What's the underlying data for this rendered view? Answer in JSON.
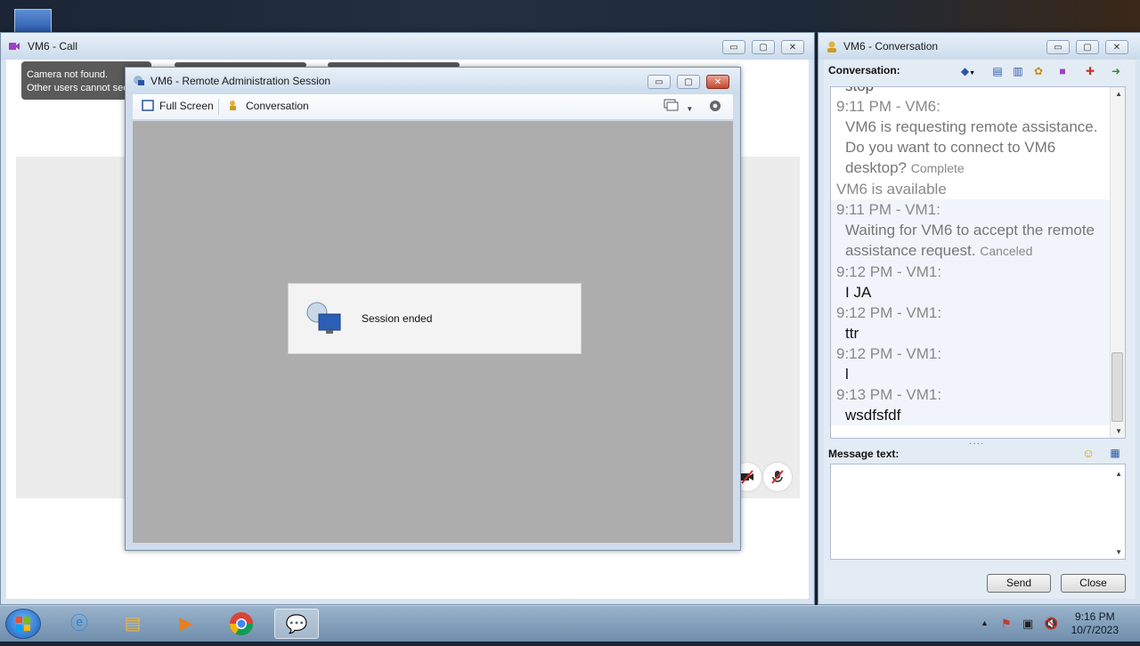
{
  "call_window": {
    "title": "VM6 - Call",
    "controls": {
      "minimize": "▭",
      "maximize": "▢",
      "close": "✕"
    },
    "camera_tip": {
      "line1": "Camera not found.",
      "line2": "Other users cannot see"
    },
    "video_button_icon": "video-off-icon",
    "mic_button_icon": "mic-off-icon"
  },
  "remote_window": {
    "title": "VM6 - Remote Administration Session",
    "controls": {
      "minimize": "▭",
      "maximize": "▢",
      "close": "✕"
    },
    "toolbar": {
      "full_screen": "Full Screen",
      "conversation": "Conversation"
    },
    "session_message": "Session ended"
  },
  "conversation_window": {
    "title": "VM6 - Conversation",
    "controls": {
      "minimize": "▭",
      "maximize": "▢",
      "close": "✕"
    },
    "conversation_label": "Conversation:",
    "messages": [
      {
        "text_top": "stop"
      },
      {
        "header": "9:11 PM - VM6:",
        "text": "VM6 is requesting remote assistance. Do you want to connect to VM6 desktop?",
        "status": "Complete"
      },
      {
        "plain": "VM6 is available"
      },
      {
        "header": "9:11 PM - VM1:",
        "text": "Waiting for VM6 to accept the remote assistance request.",
        "status": "Canceled"
      },
      {
        "header": "9:12 PM - VM1:",
        "text": "I JA"
      },
      {
        "header": "9:12 PM - VM1:",
        "text": "ttr"
      },
      {
        "header": "9:12 PM - VM1:",
        "text": "l"
      },
      {
        "header": "9:13 PM - VM1:",
        "text": "wsdfsfdf"
      }
    ],
    "message_text_label": "Message text:",
    "message_value": "",
    "send_button": "Send",
    "close_button": "Close"
  },
  "taskbar": {
    "apps": [
      "windows-explorer-icon",
      "internet-explorer-icon",
      "media-player-icon",
      "chrome-icon",
      "messenger-icon"
    ],
    "time": "9:16 PM",
    "date": "10/7/2023"
  }
}
